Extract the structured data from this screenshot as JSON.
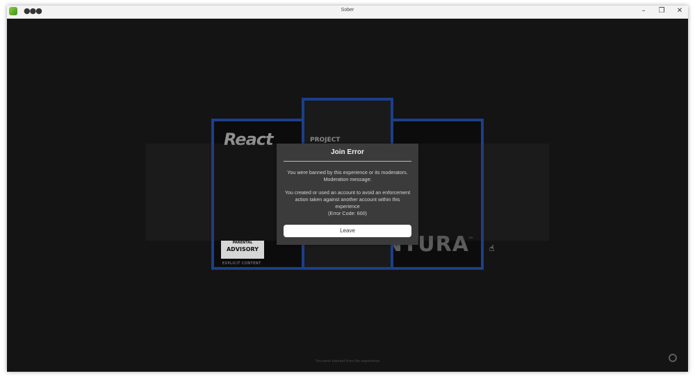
{
  "window": {
    "title": "Sober",
    "menu_icon": "more-horizontal-icon",
    "minimize_icon": "minimize-icon",
    "restore_icon": "restore-icon",
    "close_icon": "close-icon"
  },
  "background": {
    "react_logo": "React",
    "project_text": "PROJECT",
    "advisory_label": "ADVISORY",
    "advisory_top": "PARENTAL",
    "explicit_label": "EXPLICIT CONTENT",
    "ventura_text": "VENTURA",
    "tm_symbol": "™"
  },
  "modal": {
    "title": "Join Error",
    "message_line1": "You were banned by this experience or its moderators. Moderation message:",
    "message_line2": "You created or used an account to avoid an enforcement action taken against another account within this experience",
    "error_code": "(Error Code: 600)",
    "leave_label": "Leave"
  },
  "status": {
    "text": "You were banned from the experience"
  },
  "colors": {
    "accent_border": "#1c3f8a",
    "modal_bg": "#3b3b3b",
    "background": "#141414"
  }
}
